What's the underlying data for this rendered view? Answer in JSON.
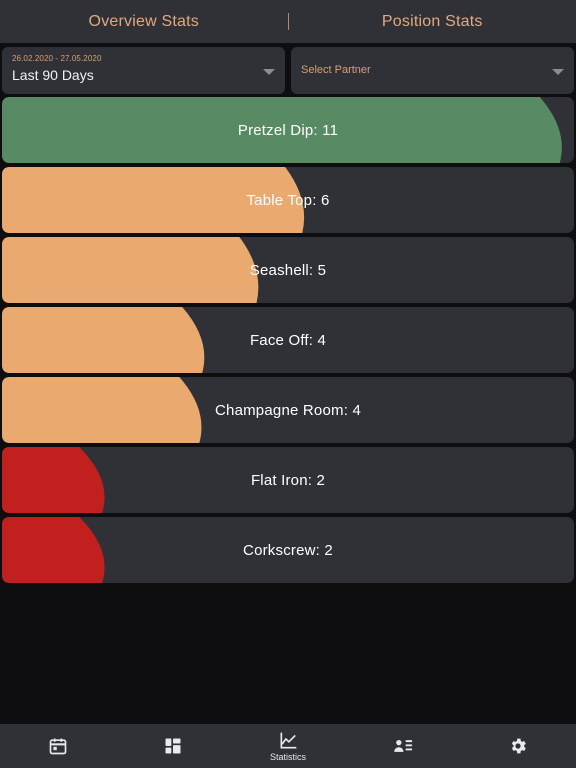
{
  "tabs": [
    {
      "label": "Overview Stats",
      "name": "tab-overview-stats"
    },
    {
      "label": "Position Stats",
      "name": "tab-position-stats"
    }
  ],
  "filters": {
    "date_range": {
      "sub_label": "26.02.2020 - 27.05.2020",
      "value": "Last 90 Days"
    },
    "partner": {
      "placeholder": "Select Partner"
    }
  },
  "colors": {
    "page_background": "#0e0e10",
    "card_background": "#2f3137",
    "accent_tan": "#e3a87c",
    "green": "#588b63",
    "orange": "#eaa96e",
    "red": "#c2201f",
    "text_white": "#ffffff"
  },
  "chart_data": {
    "type": "bar",
    "title": "",
    "xlabel": "",
    "ylabel": "",
    "orientation": "horizontal",
    "grid": false,
    "legend": "none",
    "xlim": [
      0,
      11
    ],
    "categories": [
      "Pretzel Dip",
      "Table Top",
      "Seashell",
      "Face Off",
      "Champagne Room",
      "Flat Iron",
      "Corkscrew"
    ],
    "values": [
      11,
      6,
      5,
      4,
      4,
      2,
      2
    ],
    "bars": [
      {
        "label": "Pretzel Dip: 11",
        "name": "Pretzel Dip",
        "value": 11,
        "color": "#588b63",
        "fill_top_pct": 94.0,
        "fill_bottom_pct": 97.5
      },
      {
        "label": "Table Top: 6",
        "name": "Table Top",
        "value": 6,
        "color": "#eaa96e",
        "fill_top_pct": 49.5,
        "fill_bottom_pct": 52.5
      },
      {
        "label": "Seashell: 5",
        "name": "Seashell",
        "value": 5,
        "color": "#eaa96e",
        "fill_top_pct": 41.5,
        "fill_bottom_pct": 44.5
      },
      {
        "label": "Face Off: 4",
        "name": "Face Off",
        "value": 4,
        "color": "#eaa96e",
        "fill_top_pct": 31.5,
        "fill_bottom_pct": 35.0
      },
      {
        "label": "Champagne Room: 4",
        "name": "Champagne Room",
        "value": 4,
        "color": "#eaa96e",
        "fill_top_pct": 31.0,
        "fill_bottom_pct": 34.5
      },
      {
        "label": "Flat Iron: 2",
        "name": "Flat Iron",
        "value": 2,
        "color": "#c2201f",
        "fill_top_pct": 13.5,
        "fill_bottom_pct": 17.5
      },
      {
        "label": "Corkscrew: 2",
        "name": "Corkscrew",
        "value": 2,
        "color": "#c2201f",
        "fill_top_pct": 13.5,
        "fill_bottom_pct": 17.5
      }
    ]
  },
  "bottom_nav": [
    {
      "icon": "calendar-icon",
      "label": "",
      "active": false
    },
    {
      "icon": "dashboard-icon",
      "label": "",
      "active": false
    },
    {
      "icon": "statistics-icon",
      "label": "Statistics",
      "active": true
    },
    {
      "icon": "contacts-icon",
      "label": "",
      "active": false
    },
    {
      "icon": "gear-icon",
      "label": "",
      "active": false
    }
  ]
}
